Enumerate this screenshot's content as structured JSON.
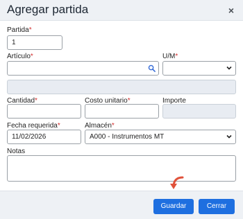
{
  "dialog": {
    "title": "Agregar partida",
    "close_symbol": "×"
  },
  "form": {
    "partida": {
      "label": "Partida",
      "value": "1"
    },
    "articulo": {
      "label": "Artículo",
      "value": ""
    },
    "um": {
      "label": "U/M",
      "value": ""
    },
    "description": {
      "value": ""
    },
    "cantidad": {
      "label": "Cantidad",
      "value": ""
    },
    "costo_unitario": {
      "label": "Costo unitario",
      "value": ""
    },
    "importe": {
      "label": "Importe",
      "value": ""
    },
    "fecha_requerida": {
      "label": "Fecha requerida",
      "value": "11/02/2026"
    },
    "almacen": {
      "label": "Almacén",
      "value": "A000 - Instrumentos MT"
    },
    "notas": {
      "label": "Notas",
      "value": ""
    },
    "required_mark": "*"
  },
  "buttons": {
    "save": "Guardar",
    "close": "Cerrar"
  },
  "colors": {
    "accent": "#1e6fe0",
    "required": "#d32f2f",
    "annotation_arrow": "#e0523b"
  }
}
